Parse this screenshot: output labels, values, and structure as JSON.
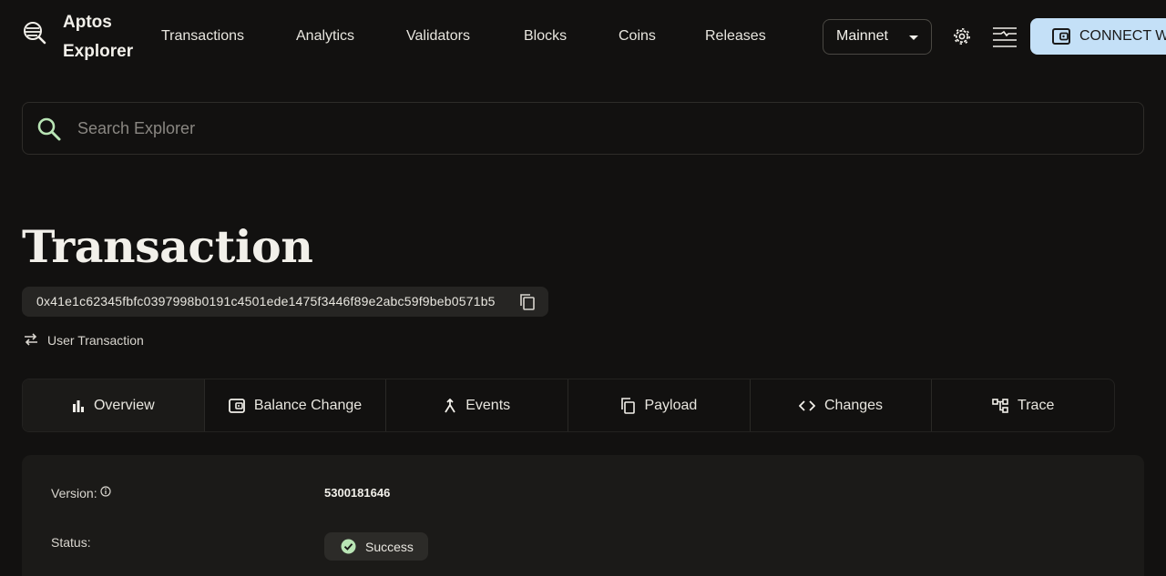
{
  "header": {
    "brand": [
      "Aptos",
      "Explorer"
    ],
    "nav": [
      {
        "label": "Transactions"
      },
      {
        "label": "Analytics"
      },
      {
        "label": "Validators"
      },
      {
        "label": "Blocks"
      },
      {
        "label": "Coins"
      },
      {
        "label": "Releases"
      }
    ],
    "network": "Mainnet",
    "connect_label": "CONNECT WALLET"
  },
  "search": {
    "placeholder": "Search Explorer",
    "value": ""
  },
  "page": {
    "title": "Transaction",
    "hash": "0x41e1c62345fbfc0397998b0191c4501ede1475f3446f89e2abc59f9beb0571b5",
    "type": "User Transaction"
  },
  "tabs": [
    {
      "label": "Overview",
      "icon": "bar-chart-icon",
      "active": true
    },
    {
      "label": "Balance Change",
      "icon": "wallet-icon"
    },
    {
      "label": "Events",
      "icon": "merge-icon"
    },
    {
      "label": "Payload",
      "icon": "copy-icon"
    },
    {
      "label": "Changes",
      "icon": "code-icon"
    },
    {
      "label": "Trace",
      "icon": "tree-icon"
    }
  ],
  "details": {
    "version_label": "Version:",
    "version_value": "5300181646",
    "status_label": "Status:",
    "status_value": "Success"
  },
  "colors": {
    "background": "#121110",
    "accent": "#c4e0f7",
    "success": "#b9e5b5"
  }
}
